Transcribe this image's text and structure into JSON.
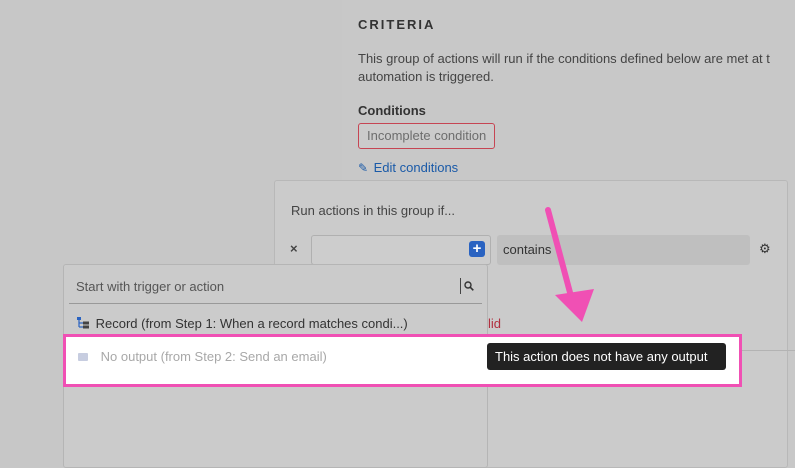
{
  "criteria": {
    "title": "CRITERIA",
    "description_line1": "This group of actions will run if the conditions defined below are met at t",
    "description_line2": "automation is triggered.",
    "conditions_label": "Conditions",
    "incomplete_badge": "Incomplete condition",
    "edit_link": "Edit conditions"
  },
  "condition_dialog": {
    "heading": "Run actions in this group if...",
    "remove_label": "×",
    "add_label": "+",
    "operator": "contains",
    "invalid_fragment": "lid"
  },
  "dropdown": {
    "search_placeholder": "Start with trigger or action",
    "options": [
      {
        "label": "Record (from Step 1: When a record matches condi...)",
        "icon": "record-icon"
      },
      {
        "label": "No output (from Step 2: Send an email)",
        "icon": "email-icon"
      }
    ]
  },
  "tooltip": {
    "text": "This action does not have any output"
  },
  "colors": {
    "highlight": "#f050b4",
    "arrow": "#f050b4",
    "link": "#1a5aa8",
    "error_border": "#c64553",
    "add_button": "#2a63c1"
  }
}
